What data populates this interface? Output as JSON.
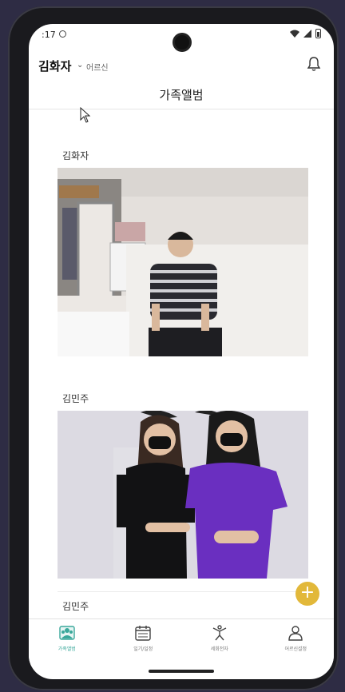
{
  "status": {
    "time": ":17"
  },
  "header": {
    "user_name": "김화자",
    "role": "어르신"
  },
  "page": {
    "title": "가족앨범"
  },
  "album": {
    "entries": [
      {
        "author": "김화자"
      },
      {
        "author": "김민주"
      },
      {
        "author": "김민주"
      }
    ]
  },
  "fab": {
    "label": "+"
  },
  "nav": {
    "items": [
      {
        "label": "가족앨범",
        "icon": "family-album-icon",
        "active": true
      },
      {
        "label": "일기/일정",
        "icon": "calendar-icon",
        "active": false
      },
      {
        "label": "세회전자",
        "icon": "stretch-person-icon",
        "active": false
      },
      {
        "label": "어르신설정",
        "icon": "person-settings-icon",
        "active": false
      }
    ]
  },
  "colors": {
    "accent": "#3aa89b",
    "fab": "#e2b83a",
    "frame": "#1a1a1e",
    "background": "#2e2c44"
  }
}
